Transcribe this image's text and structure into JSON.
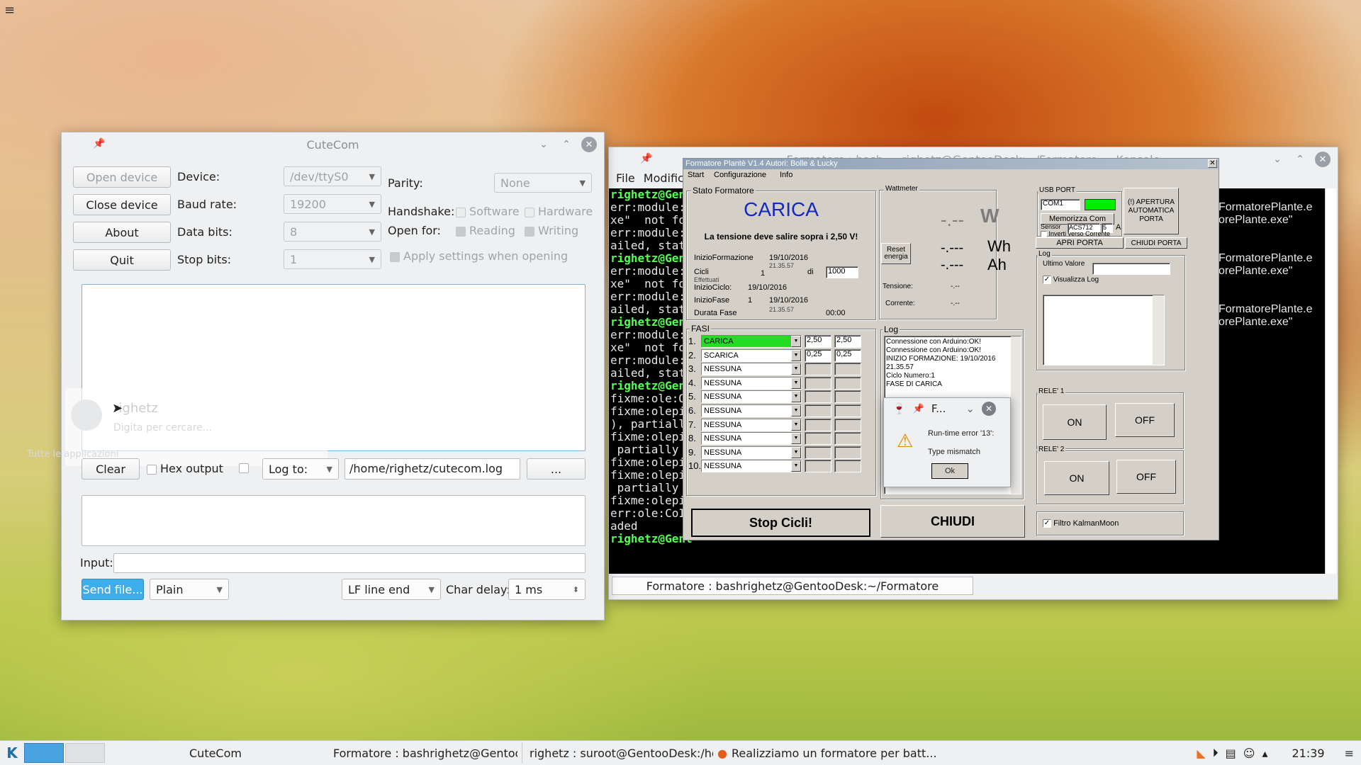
{
  "desktop": {
    "menu_icon": "hamburger-icon"
  },
  "cutecom": {
    "title": "CuteCom",
    "buttons": {
      "open": "Open device",
      "close": "Close device",
      "about": "About",
      "quit": "Quit"
    },
    "labels": {
      "device": "Device:",
      "baud": "Baud rate:",
      "databits": "Data bits:",
      "stopbits": "Stop bits:",
      "parity": "Parity:",
      "handshake": "Handshake:",
      "openfor": "Open for:"
    },
    "values": {
      "device": "/dev/ttyS0",
      "baud": "19200",
      "databits": "8",
      "stopbits": "1",
      "parity": "None"
    },
    "checks": {
      "software": "Software",
      "hardware": "Hardware",
      "reading": "Reading",
      "writing": "Writing",
      "apply": "Apply settings when opening"
    },
    "bottom": {
      "clear": "Clear",
      "hex": "Hex output",
      "logto": "Log to:",
      "logpath": "/home/righetz/cutecom.log",
      "browse": "...",
      "input": "Input:",
      "sendfile": "Send file...",
      "plain": "Plain",
      "lineend": "LF line end",
      "chardelay": "Char delay:",
      "delay": "1 ms"
    },
    "ghost": {
      "user": "righetz",
      "hint": "Digita per cercare...",
      "all": "Tutte le applicazioni"
    }
  },
  "konsole": {
    "title": "Formatore : bash — righetz@GentooDesk:~/Formatore — Konsole",
    "menu": [
      "File",
      "Modific"
    ],
    "tab": "Formatore : bashrighetz@GentooDesk:~/Formatore",
    "lines": [
      {
        "t": "righetz@Gent",
        "g": true
      },
      {
        "t": "err:module:imp",
        "g": false
      },
      {
        "t": "xe\"  not found",
        "g": false
      },
      {
        "t": "err:module:Ldi",
        "g": false
      },
      {
        "t": "ailed, status c",
        "g": false
      },
      {
        "t": "righetz@Gent",
        "g": true
      },
      {
        "t": "err:module:imp",
        "g": false
      },
      {
        "t": "xe\"  not found",
        "g": false
      },
      {
        "t": "err:module:Ldi",
        "g": false
      },
      {
        "t": "ailed, status c",
        "g": false
      },
      {
        "t": "righetz@Gent",
        "g": true
      },
      {
        "t": "err:module:imp",
        "g": false
      },
      {
        "t": "xe\"  not found",
        "g": false
      },
      {
        "t": "err:module:Ldi",
        "g": false
      },
      {
        "t": "ailed, status c",
        "g": false
      },
      {
        "t": "righetz@Gent",
        "g": true
      },
      {
        "t": "fixme:ole:OaB",
        "g": false
      },
      {
        "t": "fixme:olepictu",
        "g": false
      },
      {
        "t": "), partially imp",
        "g": false
      },
      {
        "t": "fixme:olepictu",
        "g": false
      },
      {
        "t": " partially imple",
        "g": false
      },
      {
        "t": "fixme:olepictu",
        "g": false
      },
      {
        "t": "fixme:olepictu",
        "g": false
      },
      {
        "t": " partially imple",
        "g": false
      },
      {
        "t": "fixme:olepictu",
        "g": false
      },
      {
        "t": "err:ole:CoInitia",
        "g": false
      },
      {
        "t": "aded",
        "g": false
      },
      {
        "t": "righetz@Gent",
        "g": true
      }
    ],
    "right_lines": [
      "FormatorePlante.e",
      "orePlante.exe\"",
      "",
      "",
      "FormatorePlante.e",
      "orePlante.exe\"",
      "",
      "",
      "FormatorePlante.e",
      "orePlante.exe\""
    ]
  },
  "formatore": {
    "title": "Formatore Plantè V1.4 Autori: Bolle & Lucky",
    "menu": [
      "Start",
      "Configurazione",
      "Info"
    ],
    "stato": {
      "group": "Stato Formatore",
      "status": "CARICA",
      "message": "La tensione deve salire sopra i 2,50 V!",
      "inizio_formazione_lbl": "InizioFormazione",
      "inizio_formazione": "19/10/2016",
      "inizio_formazione_time": "21.35.57",
      "cicli_lbl": "Cicli",
      "cicli": "1",
      "di": "di",
      "cicli_tot": "1000",
      "effettuati": "Effettuati",
      "inizio_ciclo_lbl": "InizioCiclo:",
      "inizio_ciclo": "19/10/2016",
      "inizio_fase_lbl": "InizioFase",
      "inizio_fase_n": "1",
      "inizio_fase": "19/10/2016",
      "durata_lbl": "Durata Fase",
      "durata": "00:00",
      "durata_extra": "21.35.57"
    },
    "watt": {
      "group": "Wattmeter",
      "w_val": "-.--",
      "w_unit": "W",
      "wh_val": "-.---",
      "wh_unit": "Wh",
      "ah_val": "-.---",
      "ah_unit": "Ah",
      "reset": "Reset energia",
      "tensione": "Tensione:",
      "corrente": "Corrente:",
      "tensione_val": "-.--",
      "corrente_val": "-.--"
    },
    "usb": {
      "group": "USB PORT",
      "port": "COM1",
      "port_color": "#00ee00",
      "memorizza": "Memorizza Com",
      "sensor_lbl": "Sensor",
      "sensor": "ACS712",
      "amp": "5",
      "amp_unit": "A",
      "inverti": "Inverti verso Corrente",
      "apri": "APRI PORTA",
      "chiudi": "CHIUDI PORTA",
      "auto": "(!) APERTURA AUTOMATICA PORTA"
    },
    "logright": {
      "group": "Log",
      "ultimo": "Ultimo Valore",
      "visualizza": "Visualizza Log"
    },
    "rele1": {
      "group": "RELE' 1",
      "on": "ON",
      "off": "OFF"
    },
    "rele2": {
      "group": "RELE' 2",
      "on": "ON",
      "off": "OFF"
    },
    "filtro": "Filtro KalmanMoon",
    "fasi": {
      "group": "FASI",
      "rows": [
        {
          "n": "1.",
          "name": "CARICA",
          "a": "2,50",
          "b": "2,50",
          "active": true
        },
        {
          "n": "2.",
          "name": "SCARICA",
          "a": "0,25",
          "b": "0,25",
          "active": false
        },
        {
          "n": "3.",
          "name": "NESSUNA",
          "a": "",
          "b": "",
          "active": false
        },
        {
          "n": "4.",
          "name": "NESSUNA",
          "a": "",
          "b": "",
          "active": false
        },
        {
          "n": "5.",
          "name": "NESSUNA",
          "a": "",
          "b": "",
          "active": false
        },
        {
          "n": "6.",
          "name": "NESSUNA",
          "a": "",
          "b": "",
          "active": false
        },
        {
          "n": "7.",
          "name": "NESSUNA",
          "a": "",
          "b": "",
          "active": false
        },
        {
          "n": "8.",
          "name": "NESSUNA",
          "a": "",
          "b": "",
          "active": false
        },
        {
          "n": "9.",
          "name": "NESSUNA",
          "a": "",
          "b": "",
          "active": false
        },
        {
          "n": "10.",
          "name": "NESSUNA",
          "a": "",
          "b": "",
          "active": false
        }
      ]
    },
    "log": {
      "group": "Log",
      "lines": [
        "Connessione con Arduino:OK!",
        "Connessione con Arduino:OK!",
        "INIZIO FORMAZIONE: 19/10/2016",
        "21.35.57",
        "Ciclo Numero:1",
        "FASE DI CARICA"
      ]
    },
    "stop": "Stop Cicli!",
    "chiudi": "CHIUDI",
    "active_color": "#22dd22"
  },
  "dialog": {
    "title": "F...",
    "message": "Run-time error '13':",
    "detail": "Type mismatch",
    "ok": "Ok"
  },
  "taskbar": {
    "tasks": [
      "CuteCom",
      "Formatore : bashrighetz@Gentoo...",
      "righetz : suroot@GentooDesk:/ho...",
      "Realizziamo un formatore per batt..."
    ],
    "clock": "21:39"
  }
}
